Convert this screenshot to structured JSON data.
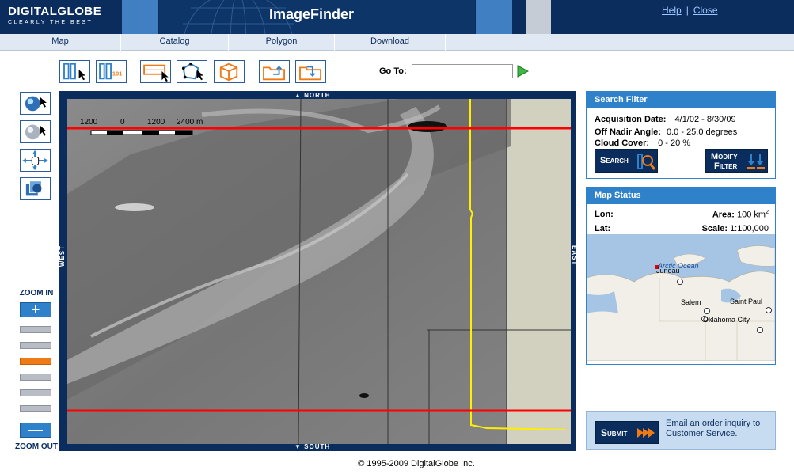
{
  "header": {
    "brand": "DIGITALGLOBE",
    "tagline": "CLEARLY THE BEST",
    "title": "ImageFinder",
    "help": "Help",
    "sep": "|",
    "close": "Close"
  },
  "nav": {
    "tabs": [
      {
        "label": "Map"
      },
      {
        "label": "Catalog"
      },
      {
        "label": "Polygon"
      },
      {
        "label": "Download"
      }
    ]
  },
  "toolbar": {
    "icons": [
      "select-columns-icon",
      "select-101-icon",
      "select-rectangle-icon",
      "select-polygon-icon",
      "select-cube-icon",
      "open-folder-icon",
      "save-folder-icon"
    ],
    "goto_label": "Go To:",
    "goto_value": "",
    "goto_icon": "play-arrow-icon"
  },
  "left_tools": {
    "icons": [
      "globe-select-icon",
      "globe-info-icon",
      "pan-hand-icon",
      "layers-icon"
    ],
    "zoom_in_label": "ZOOM IN",
    "zoom_out_label": "ZOOM OUT",
    "zoom_in_symbol": "+",
    "zoom_out_symbol": "—",
    "zoom_levels": 6,
    "zoom_level_active": 3
  },
  "map": {
    "north": "NORTH",
    "south": "SOUTH",
    "east": "EAST",
    "west": "WEST",
    "scale_labels": [
      "1200",
      "0",
      "1200",
      "2400 m"
    ],
    "line_color": "#ff0000",
    "boundary_color": "#ffee00"
  },
  "search_filter": {
    "title": "Search Filter",
    "acq_label": "Acquisition Date:",
    "acq_value": "4/1/02 - 8/30/09",
    "nadir_label": "Off Nadir Angle:",
    "nadir_value": "0.0 - 25.0 degrees",
    "cloud_label": "Cloud Cover:",
    "cloud_value": "0 - 20 %",
    "search_btn": "Search",
    "modify_btn_1": "Modify",
    "modify_btn_2": "Filter"
  },
  "map_status": {
    "title": "Map Status",
    "lon_label": "Lon:",
    "lon_value": "",
    "lat_label": "Lat:",
    "lat_value": "",
    "area_label": "Area:",
    "area_value": "100 km",
    "area_sup": "2",
    "scale_label": "Scale:",
    "scale_value": "1:100,000",
    "places": {
      "arctic": "Arctic Ocean",
      "juneau": "Juneau",
      "salem": "Salem",
      "saint_paul": "Saint Paul",
      "okc": "Oklahoma City"
    }
  },
  "submit": {
    "button": "Submit",
    "text": "Email an order inquiry to Customer Service."
  },
  "footer": {
    "copyright": "© 1995-2009 DigitalGlobe Inc."
  },
  "colors": {
    "header_navy": "#0b2d5e",
    "accent_blue": "#2f82c9",
    "accent_orange": "#ef7a16"
  }
}
